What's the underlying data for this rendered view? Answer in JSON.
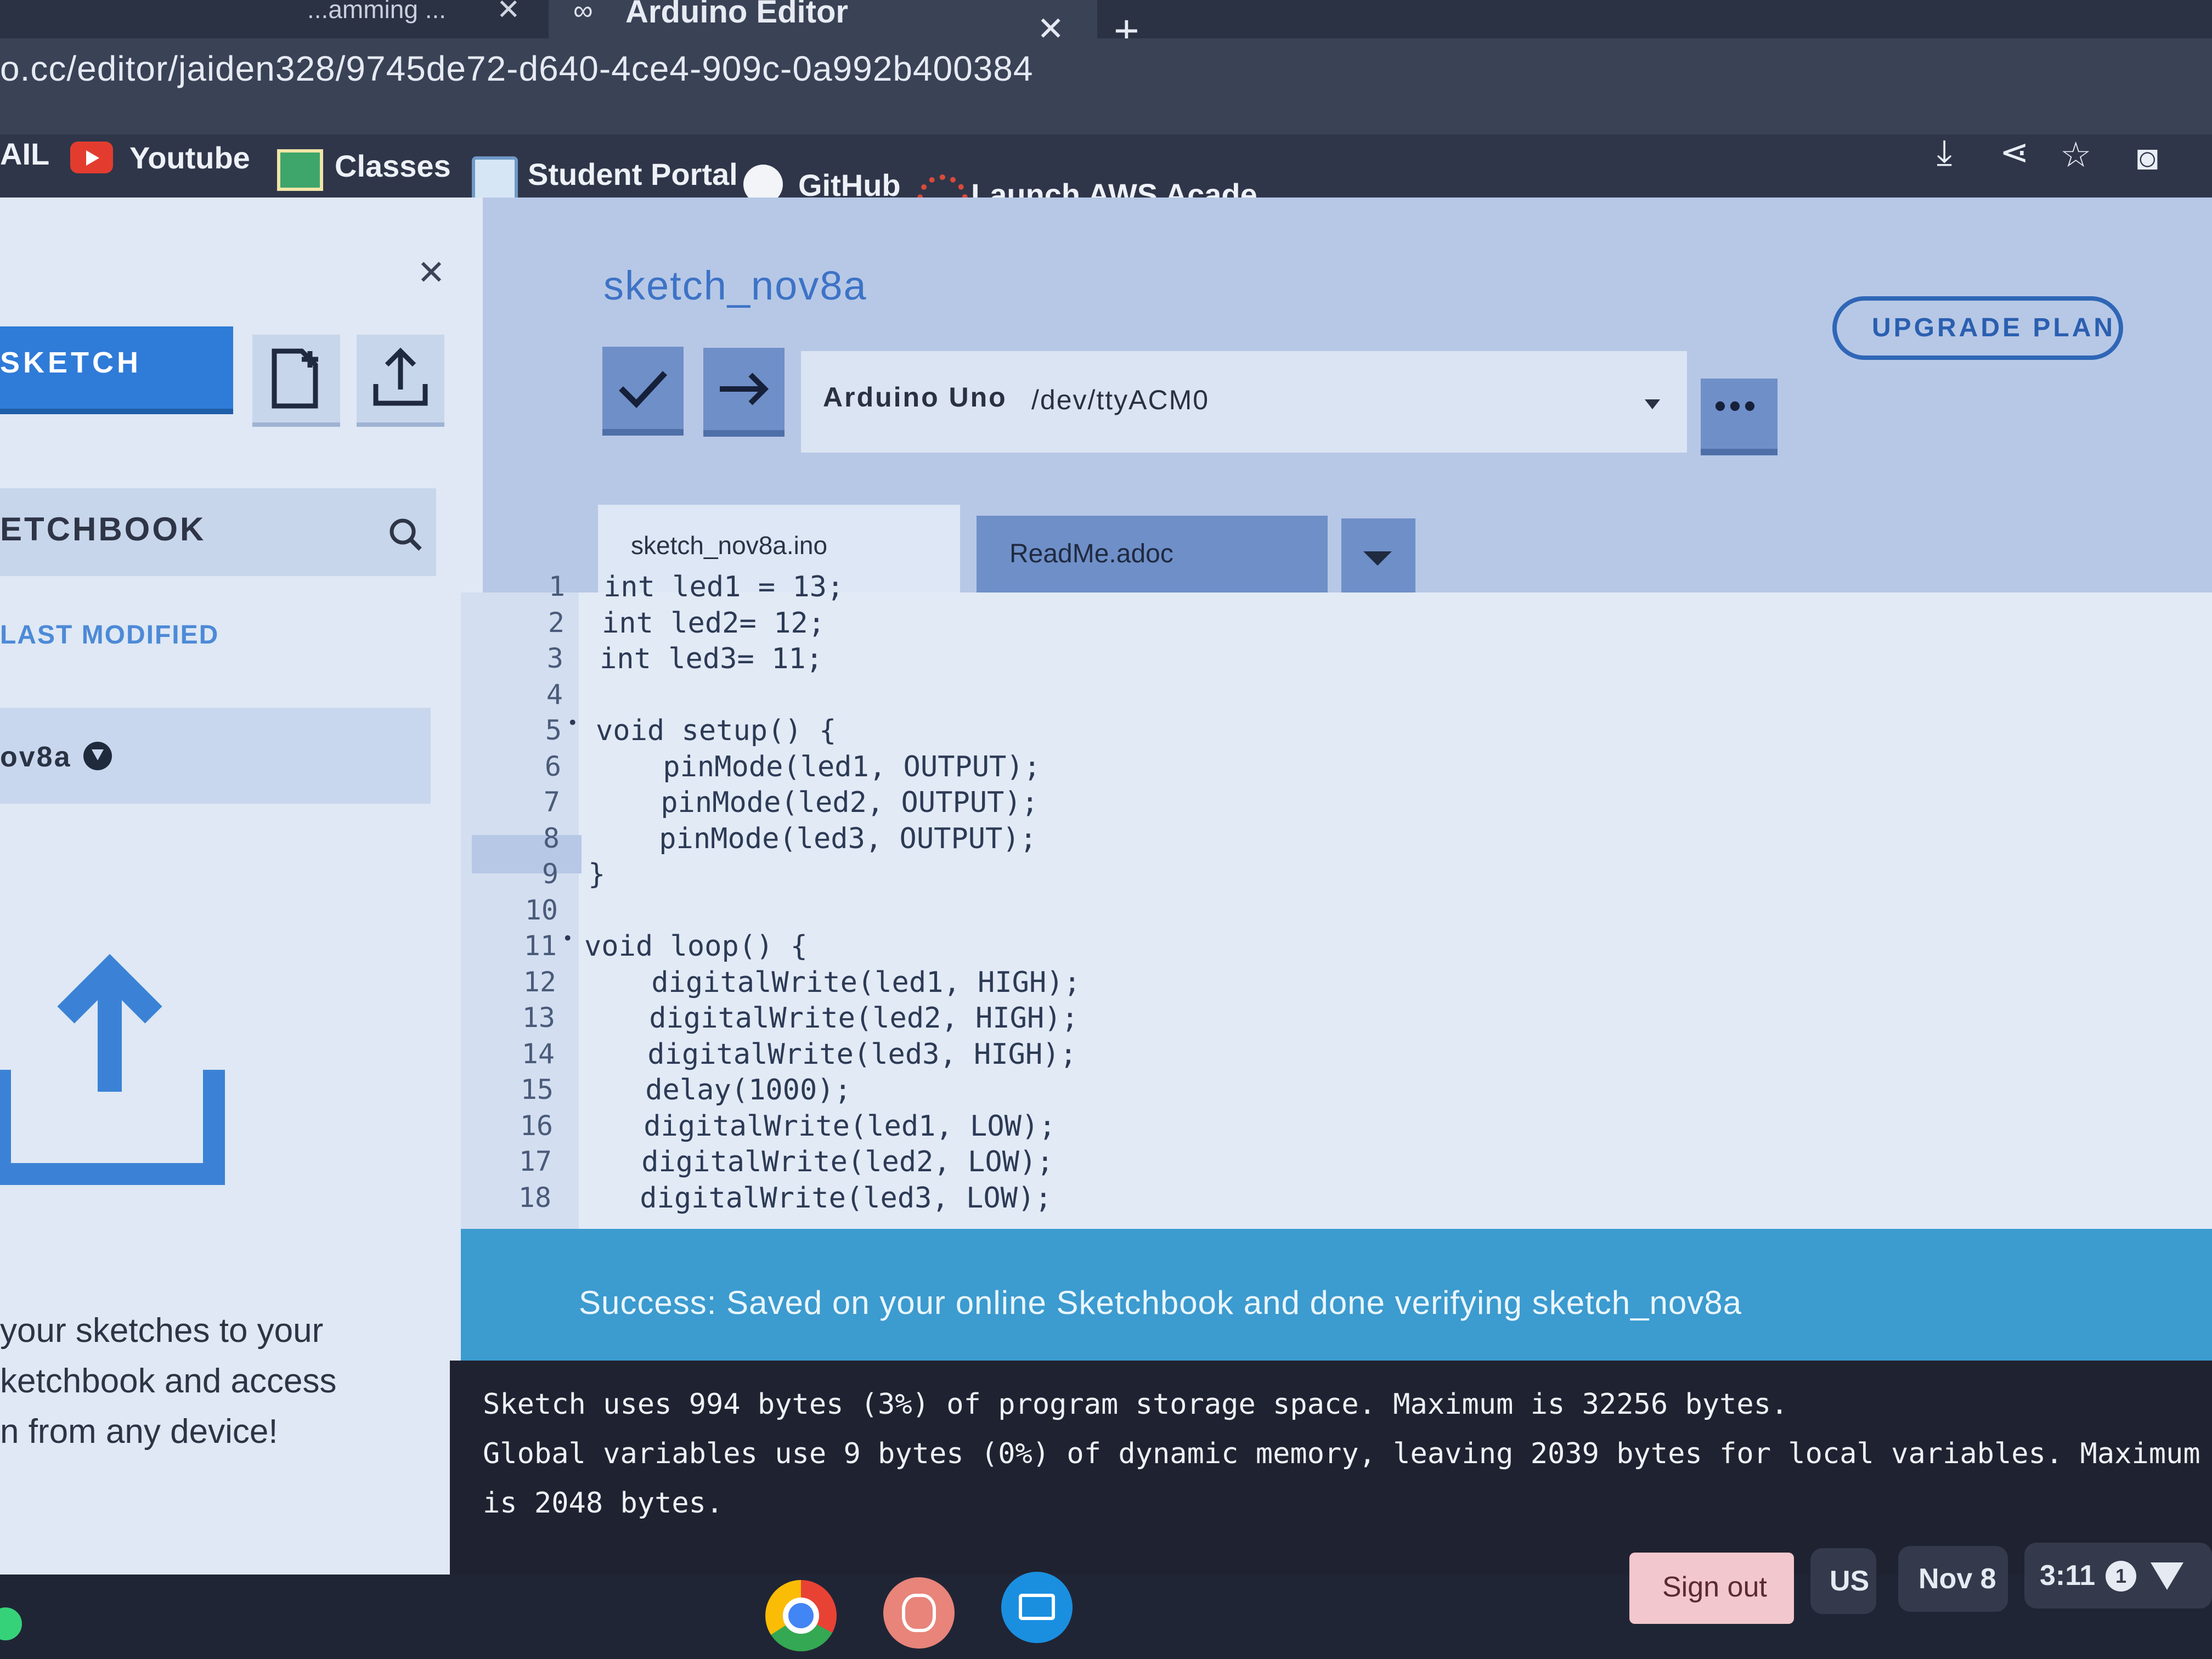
{
  "browser": {
    "tabs": [
      {
        "title": "...amming ...",
        "active": false
      },
      {
        "title": "Arduino Editor",
        "active": true
      }
    ],
    "url": "o.cc/editor/jaiden328/9745de72-d640-4ce4-909c-0a992b400384",
    "bookmarks": [
      {
        "label": "AIL",
        "icon": "mail-icon"
      },
      {
        "label": "Youtube",
        "icon": "youtube-icon"
      },
      {
        "label": "Classes",
        "icon": "classroom-icon"
      },
      {
        "label": "Student Portal",
        "icon": "portal-icon"
      },
      {
        "label": "GitHub",
        "icon": "github-icon"
      },
      {
        "label": "Launch AWS Acade...",
        "icon": "aws-icon"
      }
    ],
    "toolbar_icons": [
      "install-icon",
      "share-icon",
      "star-icon",
      "extension-icon"
    ]
  },
  "sidebar": {
    "sketch_button": "SKETCH",
    "sketchbook_label": "ETCHBOOK",
    "last_modified": "LAST MODIFIED",
    "sketch_item": "ov8a",
    "promo_lines": [
      "your sketches to your",
      "ketchbook and access",
      "n from any device!"
    ]
  },
  "editor": {
    "sketch_title": "sketch_nov8a",
    "upgrade_label": "UPGRADE PLAN",
    "board_name": "Arduino Uno",
    "board_port": "/dev/ttyACM0",
    "more_label": "•••",
    "tabs": {
      "ino": "sketch_nov8a.ino",
      "readme": "ReadMe.adoc"
    },
    "code_lines": [
      "int led1 = 13;",
      "int led2= 12;",
      "int led3= 11;",
      "",
      "void setup() {",
      "    pinMode(led1, OUTPUT);",
      "    pinMode(led2, OUTPUT);",
      "    pinMode(led3, OUTPUT);",
      "}",
      "",
      "void loop() {",
      "    digitalWrite(led1, HIGH);",
      "    digitalWrite(led2, HIGH);",
      "    digitalWrite(led3, HIGH);",
      "    delay(1000);",
      "    digitalWrite(led1, LOW);",
      "    digitalWrite(led2, LOW);",
      "    digitalWrite(led3, LOW);"
    ],
    "line_numbers": [
      "1",
      "2",
      "3",
      "4",
      "5",
      "6",
      "7",
      "8",
      "9",
      "10",
      "11",
      "12",
      "13",
      "14",
      "15",
      "16",
      "17",
      "18"
    ],
    "fold_markers": {
      "5": "•",
      "11": "•"
    },
    "highlighted_line": "8"
  },
  "status": {
    "message": "Success: Saved on your online Sketchbook and done verifying sketch_nov8a"
  },
  "console": {
    "lines": [
      "Sketch uses 994 bytes (3%) of program storage space. Maximum is 32256 bytes.",
      "Global variables use 9 bytes (0%) of dynamic memory, leaving 2039 bytes for local variables. Maximum",
      "is 2048 bytes."
    ]
  },
  "shelf": {
    "apps": [
      "chrome-icon",
      "brain-app-icon",
      "slides-app-icon"
    ],
    "sign_out": "Sign out",
    "language": "US",
    "date": "Nov 8",
    "time": "3:11",
    "notification_count": "1"
  },
  "colors": {
    "accent": "#2f7bd8",
    "toolbar_button": "#6f8fc8",
    "status_bar": "#3c9bcf",
    "console_bg": "#1f2230",
    "keyword": "#5576b8",
    "constant": "#3f8fd0"
  }
}
